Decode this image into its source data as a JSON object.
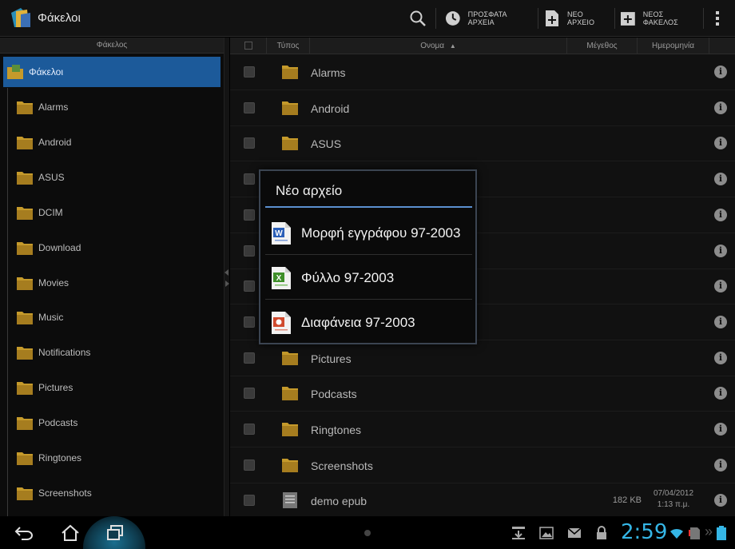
{
  "actionbar": {
    "title": "Φάκελοι",
    "search_icon": "search-icon",
    "recent_label": "ΠΡΟΣΦΑΤΑ ΑΡΧΕΙΑ",
    "new_file_label": "ΝΕΟ ΑΡΧΕΙΟ",
    "new_folder_label": "ΝΕΟΣ ΦΑΚΕΛΟΣ"
  },
  "sidebar": {
    "header": "Φάκελος",
    "root": "Φάκελοι",
    "items": [
      {
        "label": "Alarms"
      },
      {
        "label": "Android"
      },
      {
        "label": "ASUS"
      },
      {
        "label": "DCIM"
      },
      {
        "label": "Download"
      },
      {
        "label": "Movies"
      },
      {
        "label": "Music"
      },
      {
        "label": "Notifications"
      },
      {
        "label": "Pictures"
      },
      {
        "label": "Podcasts"
      },
      {
        "label": "Ringtones"
      },
      {
        "label": "Screenshots"
      }
    ]
  },
  "filelist": {
    "columns": {
      "type": "Τύπος",
      "name": "Ονομα",
      "size": "Μέγεθος",
      "date": "Ημερομηνία"
    },
    "rows": [
      {
        "name": "Alarms",
        "size": "",
        "date": "",
        "time": ""
      },
      {
        "name": "Android",
        "size": "",
        "date": "",
        "time": ""
      },
      {
        "name": "ASUS",
        "size": "",
        "date": "",
        "time": ""
      },
      {
        "name": "",
        "size": "",
        "date": "",
        "time": ""
      },
      {
        "name": "",
        "size": "",
        "date": "",
        "time": ""
      },
      {
        "name": "",
        "size": "",
        "date": "",
        "time": ""
      },
      {
        "name": "",
        "size": "",
        "date": "",
        "time": ""
      },
      {
        "name": "",
        "size": "",
        "date": "",
        "time": ""
      },
      {
        "name": "Pictures",
        "size": "",
        "date": "",
        "time": ""
      },
      {
        "name": "Podcasts",
        "size": "",
        "date": "",
        "time": ""
      },
      {
        "name": "Ringtones",
        "size": "",
        "date": "",
        "time": ""
      },
      {
        "name": "Screenshots",
        "size": "",
        "date": "",
        "time": ""
      },
      {
        "name": "demo epub",
        "size": "182 KB",
        "date": "07/04/2012",
        "time": "1:13 π.μ."
      }
    ]
  },
  "dialog": {
    "title": "Νέο αρχείο",
    "items": [
      {
        "label": "Μορφή εγγράφου 97-2003",
        "icon": "word-document-icon"
      },
      {
        "label": "Φύλλο 97-2003",
        "icon": "spreadsheet-icon"
      },
      {
        "label": "Διαφάνεια 97-2003",
        "icon": "presentation-icon"
      }
    ]
  },
  "sysbar": {
    "clock": "2:59"
  },
  "colors": {
    "accent_blue": "#1c5a9a",
    "dialog_line": "#5b8fcf",
    "clock": "#35b6e6",
    "folder": "#c59a2b"
  }
}
